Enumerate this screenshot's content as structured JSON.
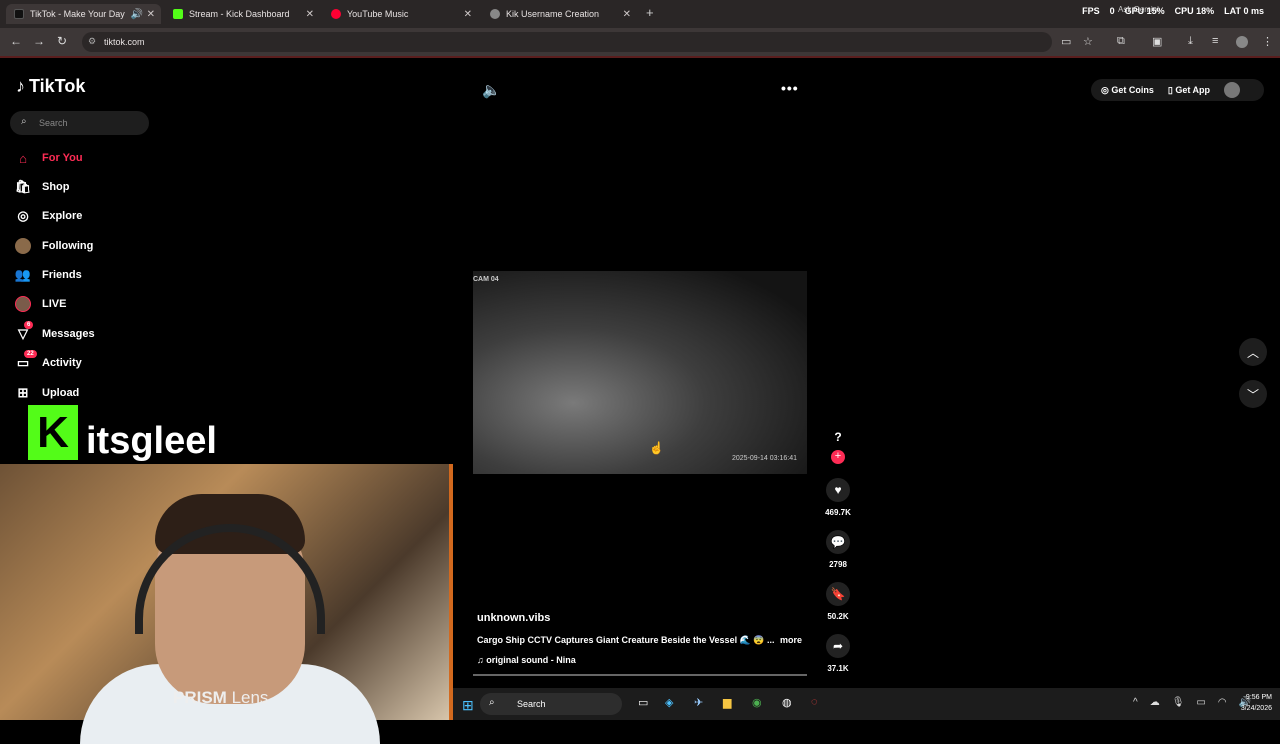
{
  "browser": {
    "tabs": [
      {
        "label": "TikTok - Make Your Day",
        "color": "#111111"
      },
      {
        "label": "Stream - Kick Dashboard",
        "color": "#53fc18"
      },
      {
        "label": "YouTube Music",
        "color": "#ff0033"
      },
      {
        "label": "Kik Username Creation",
        "color": "#888888"
      }
    ],
    "url": "tiktok.com",
    "perf": {
      "fps_label": "FPS",
      "fps": "0",
      "gpu": "GPU 15%",
      "cpu": "CPU 18%",
      "lat": "LAT 0 ms"
    },
    "gemini": "Ask Gemini"
  },
  "tiktok": {
    "logo": "TikTok",
    "search_placeholder": "Search",
    "nav": [
      {
        "label": "For You",
        "icon": "home-icon",
        "active": true
      },
      {
        "label": "Shop",
        "icon": "shop-icon"
      },
      {
        "label": "Explore",
        "icon": "compass-icon"
      },
      {
        "label": "Following",
        "icon": "following-avatar-icon"
      },
      {
        "label": "Friends",
        "icon": "friends-icon"
      },
      {
        "label": "LIVE",
        "icon": "live-avatar-icon"
      },
      {
        "label": "Messages",
        "icon": "messages-icon",
        "badge": "6"
      },
      {
        "label": "Activity",
        "icon": "activity-icon",
        "badge": "22"
      },
      {
        "label": "Upload",
        "icon": "upload-icon"
      }
    ],
    "header": {
      "get_coins": "Get Coins",
      "get_app": "Get App"
    },
    "video": {
      "cam_label": "CAM 04",
      "timestamp": "2025-09-14  03:16:41",
      "username": "unknown.vibs",
      "description": "Cargo Ship CCTV Captures Giant Creature Beside the Vessel 🌊 😨 ...",
      "more": "more",
      "sound": "original sound - Nina",
      "likes": "469.7K",
      "comments": "2798",
      "saves": "50.2K",
      "shares": "37.1K",
      "accent_color": "#fe2c55"
    }
  },
  "overlay": {
    "kick_logo": "K",
    "kick_name": "itsgleel",
    "webcam_label_bold": "PRISM",
    "webcam_label": " Lens"
  },
  "taskbar": {
    "search": "Search",
    "time": "9:56 PM",
    "date": "3/24/2026"
  }
}
